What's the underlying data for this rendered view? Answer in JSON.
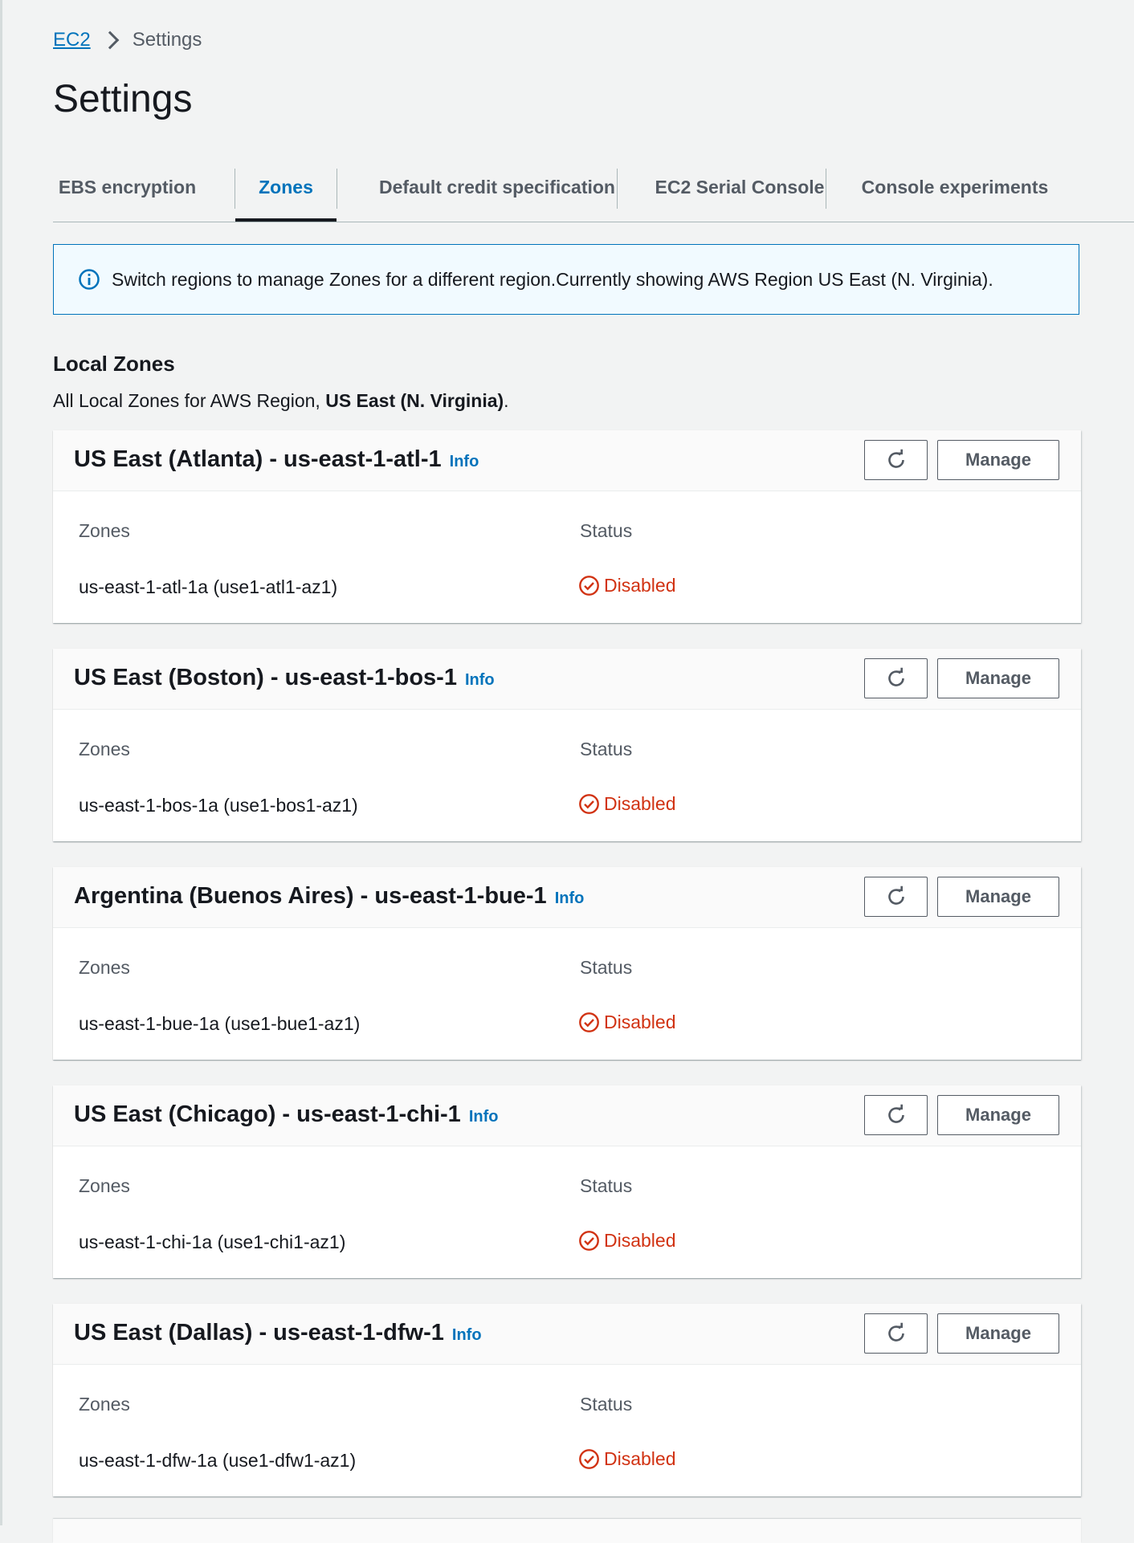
{
  "breadcrumb": {
    "root": "EC2",
    "current": "Settings"
  },
  "page_title": "Settings",
  "tabs": [
    {
      "label": "EBS encryption",
      "active": false
    },
    {
      "label": "Zones",
      "active": true
    },
    {
      "label": "Default credit specification",
      "active": false
    },
    {
      "label": "EC2 Serial Console",
      "active": false
    },
    {
      "label": "Console experiments",
      "active": false
    }
  ],
  "alert": {
    "icon": "info-circle-icon",
    "text": "Switch regions to manage Zones for a different region.Currently showing AWS Region US East (N. Virginia)."
  },
  "local_zones": {
    "title": "Local Zones",
    "desc_prefix": "All Local Zones for AWS Region, ",
    "desc_region": "US East (N. Virginia)",
    "desc_suffix": "."
  },
  "zone_groups": [
    {
      "title": "US East (Atlanta) - us-east-1-atl-1",
      "info": "Info",
      "zones_label": "Zones",
      "status_label": "Status",
      "zone": "us-east-1-atl-1a (use1-atl1-az1)",
      "status": "Disabled",
      "manage": "Manage"
    },
    {
      "title": "US East (Boston) - us-east-1-bos-1",
      "info": "Info",
      "zones_label": "Zones",
      "status_label": "Status",
      "zone": "us-east-1-bos-1a (use1-bos1-az1)",
      "status": "Disabled",
      "manage": "Manage"
    },
    {
      "title": "Argentina (Buenos Aires) - us-east-1-bue-1",
      "info": "Info",
      "zones_label": "Zones",
      "status_label": "Status",
      "zone": "us-east-1-bue-1a (use1-bue1-az1)",
      "status": "Disabled",
      "manage": "Manage"
    },
    {
      "title": "US East (Chicago) - us-east-1-chi-1",
      "info": "Info",
      "zones_label": "Zones",
      "status_label": "Status",
      "zone": "us-east-1-chi-1a (use1-chi1-az1)",
      "status": "Disabled",
      "manage": "Manage"
    },
    {
      "title": "US East (Dallas) - us-east-1-dfw-1",
      "info": "Info",
      "zones_label": "Zones",
      "status_label": "Status",
      "zone": "us-east-1-dfw-1a (use1-dfw1-az1)",
      "status": "Disabled",
      "manage": "Manage"
    }
  ],
  "colors": {
    "link": "#0073bb",
    "status_disabled": "#d13212",
    "tab_active_underline": "#16191f",
    "alert_bg": "#f1faff"
  }
}
